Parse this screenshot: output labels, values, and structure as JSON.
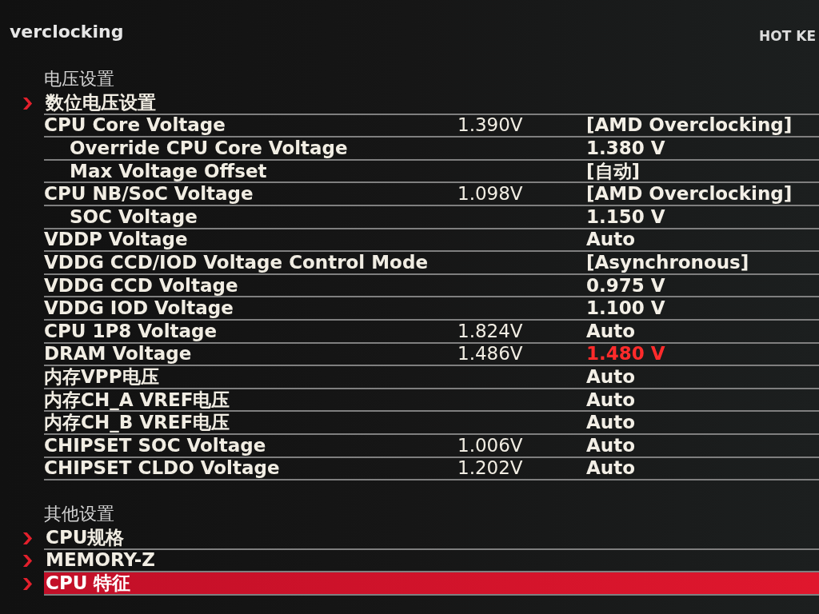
{
  "header": {
    "title": "verclocking",
    "hot_key": "HOT KE"
  },
  "sections": [
    {
      "title": "电压设置",
      "items": [
        {
          "kind": "submenu",
          "label": "数位电压设置",
          "selected": false
        },
        {
          "kind": "setting",
          "label": "CPU Core Voltage",
          "current": "1.390V",
          "value": "[AMD Overclocking]",
          "warning": false,
          "children": [
            {
              "kind": "setting",
              "label": "Override CPU Core Voltage",
              "value": "1.380 V",
              "warning": false
            },
            {
              "kind": "setting",
              "label": "Max Voltage Offset",
              "value": "[自动]",
              "warning": false
            }
          ]
        },
        {
          "kind": "setting",
          "label": "CPU NB/SoC Voltage",
          "current": "1.098V",
          "value": "[AMD Overclocking]",
          "warning": false,
          "children": [
            {
              "kind": "setting",
              "label": "SOC Voltage",
              "value": "1.150 V",
              "warning": false
            }
          ]
        },
        {
          "kind": "setting",
          "label": "VDDP Voltage",
          "value": "Auto",
          "warning": false
        },
        {
          "kind": "setting",
          "label": "VDDG CCD/IOD Voltage Control Mode",
          "value": "[Asynchronous]",
          "warning": false
        },
        {
          "kind": "setting",
          "label": "VDDG CCD Voltage",
          "value": "0.975 V",
          "warning": false
        },
        {
          "kind": "setting",
          "label": "VDDG IOD Voltage",
          "value": "1.100 V",
          "warning": false
        },
        {
          "kind": "setting",
          "label": "CPU 1P8 Voltage",
          "current": "1.824V",
          "value": "Auto",
          "warning": false
        },
        {
          "kind": "setting",
          "label": "DRAM Voltage",
          "current": "1.486V",
          "value": "1.480 V",
          "warning": true
        },
        {
          "kind": "setting",
          "label": "内存VPP电压",
          "value": "Auto",
          "warning": false
        },
        {
          "kind": "setting",
          "label": "内存CH_A VREF电压",
          "value": "Auto",
          "warning": false
        },
        {
          "kind": "setting",
          "label": "内存CH_B VREF电压",
          "value": "Auto",
          "warning": false
        },
        {
          "kind": "setting",
          "label": "CHIPSET SOC Voltage",
          "current": "1.006V",
          "value": "Auto",
          "warning": false
        },
        {
          "kind": "setting",
          "label": "CHIPSET CLDO Voltage",
          "current": "1.202V",
          "value": "Auto",
          "warning": false
        }
      ]
    },
    {
      "title": "其他设置",
      "items": [
        {
          "kind": "submenu",
          "label": "CPU规格",
          "selected": false
        },
        {
          "kind": "submenu",
          "label": "MEMORY-Z",
          "selected": false
        },
        {
          "kind": "submenu",
          "label": "CPU 特征",
          "selected": true
        }
      ]
    }
  ]
}
